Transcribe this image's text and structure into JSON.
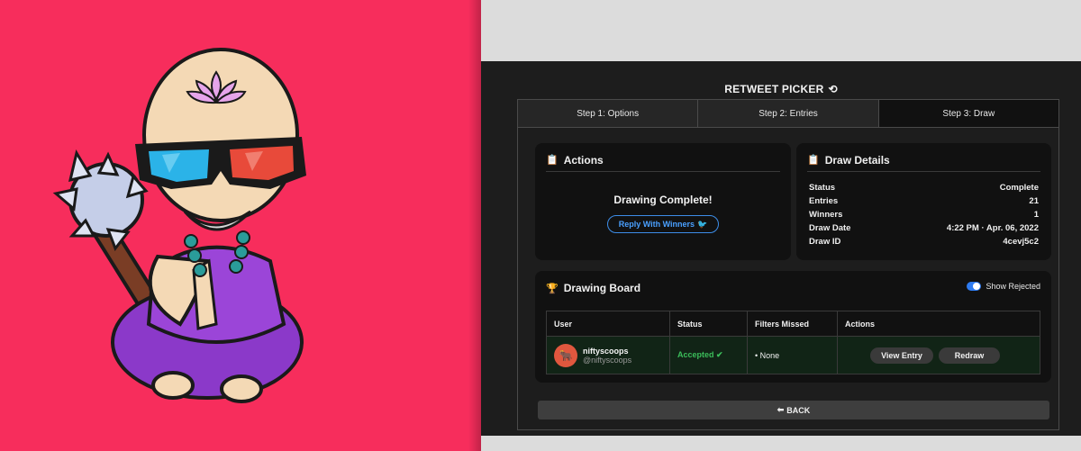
{
  "app": {
    "title": "RETWEET PICKER",
    "title_icon": "retweet-icon"
  },
  "tabs": [
    {
      "label": "Step 1: Options"
    },
    {
      "label": "Step 2: Entries"
    },
    {
      "label": "Step 3: Draw"
    }
  ],
  "actions": {
    "title": "Actions",
    "icon": "clipboard-check-icon",
    "status_message": "Drawing Complete!",
    "reply_label": "Reply With Winners",
    "reply_icon": "twitter-icon"
  },
  "details": {
    "title": "Draw Details",
    "icon": "clipboard-list-icon",
    "rows": [
      {
        "label": "Status",
        "value": "Complete"
      },
      {
        "label": "Entries",
        "value": "21"
      },
      {
        "label": "Winners",
        "value": "1"
      },
      {
        "label": "Draw Date",
        "value": "4:22 PM · Apr. 06, 2022"
      },
      {
        "label": "Draw ID",
        "value": "4cevj5c2"
      }
    ]
  },
  "board": {
    "title": "Drawing Board",
    "icon": "trophy-icon",
    "toggle_label": "Show Rejected",
    "toggle_on": true,
    "columns": [
      "User",
      "Status",
      "Filters Missed",
      "Actions"
    ],
    "rows": [
      {
        "name": "niftyscoops",
        "handle": "@niftyscoops",
        "status": "Accepted",
        "filters": "• None",
        "view_label": "View Entry",
        "redraw_label": "Redraw"
      }
    ]
  },
  "back": {
    "label": "BACK",
    "icon": "arrow-circle-left-icon"
  },
  "colors": {
    "left_background": "#f72d5c",
    "app_background": "#1d1d1d",
    "panel_background": "#111111",
    "accent_blue": "#3d8de8",
    "accepted_green": "#3bbd5a"
  }
}
